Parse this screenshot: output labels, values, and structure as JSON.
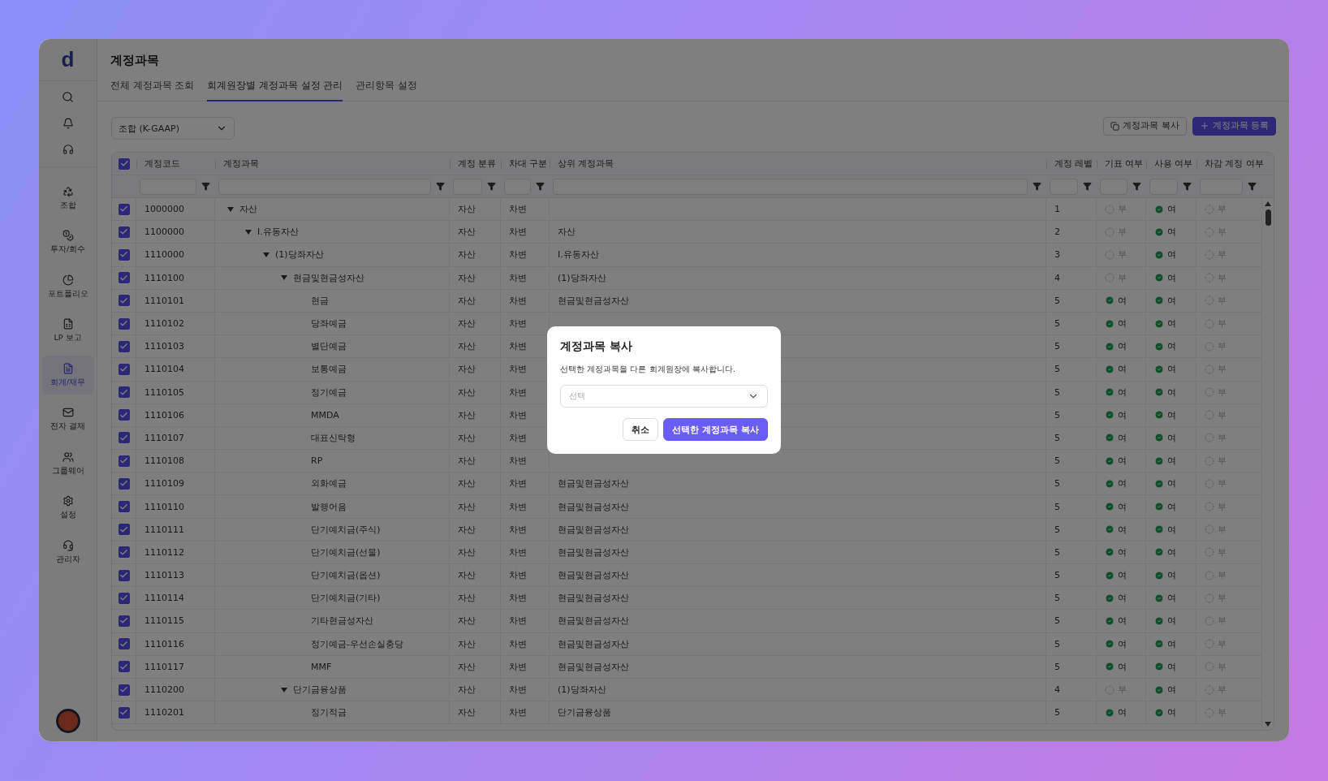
{
  "sidebar": {
    "logo": "d",
    "items": [
      {
        "label": "조합",
        "selected": false
      },
      {
        "label": "투자/회수",
        "selected": false
      },
      {
        "label": "포트폴리오",
        "selected": false
      },
      {
        "label": "LP 보고",
        "selected": false
      },
      {
        "label": "회계/재무",
        "selected": true
      },
      {
        "label": "전자 결재",
        "selected": false
      },
      {
        "label": "그룹웨어",
        "selected": false
      },
      {
        "label": "설정",
        "selected": false
      },
      {
        "label": "관리자",
        "selected": false
      }
    ]
  },
  "page": {
    "title": "계정과목",
    "tabs": [
      {
        "label": "전체 계정과목 조회",
        "selected": false
      },
      {
        "label": "회계원장별 계정과목 설정 관리",
        "selected": true
      },
      {
        "label": "관리항목 설정",
        "selected": false
      }
    ],
    "ledger_select": {
      "value": "조합 (K-GAAP)"
    },
    "buttons": [
      {
        "label": "계정과목 복사",
        "kind": "outline"
      },
      {
        "label": "계정과목 등록",
        "kind": "primary"
      }
    ]
  },
  "table": {
    "select_all": {
      "checked": true
    },
    "columns": [
      "계정코드",
      "계정과목",
      "계정 분류",
      "차대 구분",
      "상위 계정과목",
      "계정 레벨",
      "기표 여부",
      "사용 여부",
      "차감 계정 여부"
    ],
    "rows": [
      {
        "checked": true,
        "code": "1000000",
        "name": "자산",
        "expanded": true,
        "category": "자산",
        "side": "차변",
        "account_level": "1",
        "posting": {
          "text": "부",
          "on": false
        },
        "in_use": {
          "text": "여",
          "on": true
        },
        "contra": {
          "text": "부",
          "on": false
        },
        "children": [
          {
            "checked": true,
            "code": "1100000",
            "name": "I.유동자산",
            "expanded": true,
            "category": "자산",
            "side": "차변",
            "parent": "자산",
            "account_level": "2",
            "posting": {
              "text": "부",
              "on": false
            },
            "in_use": {
              "text": "여",
              "on": true
            },
            "contra": {
              "text": "부",
              "on": false
            },
            "children": [
              {
                "checked": true,
                "code": "1110000",
                "name": "(1)당좌자산",
                "expanded": true,
                "category": "자산",
                "side": "차변",
                "parent": "I.유동자산",
                "account_level": "3",
                "posting": {
                  "text": "부",
                  "on": false
                },
                "in_use": {
                  "text": "여",
                  "on": true
                },
                "contra": {
                  "text": "부",
                  "on": false
                },
                "children": [
                  {
                    "checked": true,
                    "code": "1110100",
                    "name": "현금및현금성자산",
                    "expanded": true,
                    "category": "자산",
                    "side": "차변",
                    "parent": "(1)당좌자산",
                    "account_level": "4",
                    "posting": {
                      "text": "부",
                      "on": false
                    },
                    "in_use": {
                      "text": "여",
                      "on": true
                    },
                    "contra": {
                      "text": "부",
                      "on": false
                    },
                    "children": [
                      {
                        "checked": true,
                        "code": "1110101",
                        "name": "현금",
                        "category": "자산",
                        "side": "차변",
                        "parent": "현금및현금성자산",
                        "account_level": "5",
                        "posting": {
                          "text": "여",
                          "on": true
                        },
                        "in_use": {
                          "text": "여",
                          "on": true
                        },
                        "contra": {
                          "text": "부",
                          "on": false
                        }
                      },
                      {
                        "checked": true,
                        "code": "1110102",
                        "name": "당좌예금",
                        "category": "자산",
                        "side": "차변",
                        "account_level": "5",
                        "posting": {
                          "text": "여",
                          "on": true
                        },
                        "in_use": {
                          "text": "여",
                          "on": true
                        },
                        "contra": {
                          "text": "부",
                          "on": false
                        }
                      },
                      {
                        "checked": true,
                        "code": "1110103",
                        "name": "별단예금",
                        "category": "자산",
                        "side": "차변",
                        "account_level": "5",
                        "posting": {
                          "text": "여",
                          "on": true
                        },
                        "in_use": {
                          "text": "여",
                          "on": true
                        },
                        "contra": {
                          "text": "부",
                          "on": false
                        }
                      },
                      {
                        "checked": true,
                        "code": "1110104",
                        "name": "보통예금",
                        "category": "자산",
                        "side": "차변",
                        "account_level": "5",
                        "posting": {
                          "text": "여",
                          "on": true
                        },
                        "in_use": {
                          "text": "여",
                          "on": true
                        },
                        "contra": {
                          "text": "부",
                          "on": false
                        }
                      },
                      {
                        "checked": true,
                        "code": "1110105",
                        "name": "정기예금",
                        "category": "자산",
                        "side": "차변",
                        "account_level": "5",
                        "posting": {
                          "text": "여",
                          "on": true
                        },
                        "in_use": {
                          "text": "여",
                          "on": true
                        },
                        "contra": {
                          "text": "부",
                          "on": false
                        }
                      },
                      {
                        "checked": true,
                        "code": "1110106",
                        "name": "MMDA",
                        "category": "자산",
                        "side": "차변",
                        "account_level": "5",
                        "posting": {
                          "text": "여",
                          "on": true
                        },
                        "in_use": {
                          "text": "여",
                          "on": true
                        },
                        "contra": {
                          "text": "부",
                          "on": false
                        }
                      },
                      {
                        "checked": true,
                        "code": "1110107",
                        "name": "대표신탁형",
                        "category": "자산",
                        "side": "차변",
                        "account_level": "5",
                        "posting": {
                          "text": "여",
                          "on": true
                        },
                        "in_use": {
                          "text": "여",
                          "on": true
                        },
                        "contra": {
                          "text": "부",
                          "on": false
                        }
                      },
                      {
                        "checked": true,
                        "code": "1110108",
                        "name": "RP",
                        "category": "자산",
                        "side": "차변",
                        "account_level": "5",
                        "posting": {
                          "text": "여",
                          "on": true
                        },
                        "in_use": {
                          "text": "여",
                          "on": true
                        },
                        "contra": {
                          "text": "부",
                          "on": false
                        }
                      },
                      {
                        "checked": true,
                        "code": "1110109",
                        "name": "외화예금",
                        "category": "자산",
                        "side": "차변",
                        "parent": "현금및현금성자산",
                        "account_level": "5",
                        "posting": {
                          "text": "여",
                          "on": true
                        },
                        "in_use": {
                          "text": "여",
                          "on": true
                        },
                        "contra": {
                          "text": "부",
                          "on": false
                        }
                      },
                      {
                        "checked": true,
                        "code": "1110110",
                        "name": "발행어음",
                        "category": "자산",
                        "side": "차변",
                        "parent": "현금및현금성자산",
                        "account_level": "5",
                        "posting": {
                          "text": "여",
                          "on": true
                        },
                        "in_use": {
                          "text": "여",
                          "on": true
                        },
                        "contra": {
                          "text": "부",
                          "on": false
                        }
                      },
                      {
                        "checked": true,
                        "code": "1110111",
                        "name": "단기예치금(주식)",
                        "category": "자산",
                        "side": "차변",
                        "parent": "현금및현금성자산",
                        "account_level": "5",
                        "posting": {
                          "text": "여",
                          "on": true
                        },
                        "in_use": {
                          "text": "여",
                          "on": true
                        },
                        "contra": {
                          "text": "부",
                          "on": false
                        }
                      },
                      {
                        "checked": true,
                        "code": "1110112",
                        "name": "단기예치금(선물)",
                        "category": "자산",
                        "side": "차변",
                        "parent": "현금및현금성자산",
                        "account_level": "5",
                        "posting": {
                          "text": "여",
                          "on": true
                        },
                        "in_use": {
                          "text": "여",
                          "on": true
                        },
                        "contra": {
                          "text": "부",
                          "on": false
                        }
                      },
                      {
                        "checked": true,
                        "code": "1110113",
                        "name": "단기예치금(옵션)",
                        "category": "자산",
                        "side": "차변",
                        "parent": "현금및현금성자산",
                        "account_level": "5",
                        "posting": {
                          "text": "여",
                          "on": true
                        },
                        "in_use": {
                          "text": "여",
                          "on": true
                        },
                        "contra": {
                          "text": "부",
                          "on": false
                        }
                      },
                      {
                        "checked": true,
                        "code": "1110114",
                        "name": "단기예치금(기타)",
                        "category": "자산",
                        "side": "차변",
                        "parent": "현금및현금성자산",
                        "account_level": "5",
                        "posting": {
                          "text": "여",
                          "on": true
                        },
                        "in_use": {
                          "text": "여",
                          "on": true
                        },
                        "contra": {
                          "text": "부",
                          "on": false
                        }
                      },
                      {
                        "checked": true,
                        "code": "1110115",
                        "name": "기타현금성자산",
                        "category": "자산",
                        "side": "차변",
                        "parent": "현금및현금성자산",
                        "account_level": "5",
                        "posting": {
                          "text": "여",
                          "on": true
                        },
                        "in_use": {
                          "text": "여",
                          "on": true
                        },
                        "contra": {
                          "text": "부",
                          "on": false
                        }
                      },
                      {
                        "checked": true,
                        "code": "1110116",
                        "name": "정기예금-우선손실충당",
                        "category": "자산",
                        "side": "차변",
                        "parent": "현금및현금성자산",
                        "account_level": "5",
                        "posting": {
                          "text": "여",
                          "on": true
                        },
                        "in_use": {
                          "text": "여",
                          "on": true
                        },
                        "contra": {
                          "text": "부",
                          "on": false
                        }
                      },
                      {
                        "checked": true,
                        "code": "1110117",
                        "name": "MMF",
                        "category": "자산",
                        "side": "차변",
                        "parent": "현금및현금성자산",
                        "account_level": "5",
                        "posting": {
                          "text": "여",
                          "on": true
                        },
                        "in_use": {
                          "text": "여",
                          "on": true
                        },
                        "contra": {
                          "text": "부",
                          "on": false
                        }
                      }
                    ]
                  },
                  {
                    "checked": true,
                    "code": "1110200",
                    "name": "단기금융상품",
                    "expanded": true,
                    "category": "자산",
                    "side": "차변",
                    "parent": "(1)당좌자산",
                    "account_level": "4",
                    "posting": {
                      "text": "부",
                      "on": false
                    },
                    "in_use": {
                      "text": "여",
                      "on": true
                    },
                    "contra": {
                      "text": "부",
                      "on": false
                    },
                    "children": [
                      {
                        "checked": true,
                        "code": "1110201",
                        "name": "정기적금",
                        "category": "자산",
                        "side": "차변",
                        "parent": "단기금융상품",
                        "account_level": "5",
                        "posting": {
                          "text": "여",
                          "on": true
                        },
                        "in_use": {
                          "text": "여",
                          "on": true
                        },
                        "contra": {
                          "text": "부",
                          "on": false
                        }
                      }
                    ]
                  }
                ]
              }
            ]
          }
        ]
      }
    ]
  },
  "dialog": {
    "title": "계정과목 복사",
    "message": "선택한 계정과목을 다른 회계원장에 복사합니다.",
    "select": {
      "placeholder": "선택"
    },
    "buttons": [
      {
        "label": "취소",
        "kind": "secondary"
      },
      {
        "label": "선택한 계정과목 복사",
        "kind": "primary"
      }
    ]
  }
}
